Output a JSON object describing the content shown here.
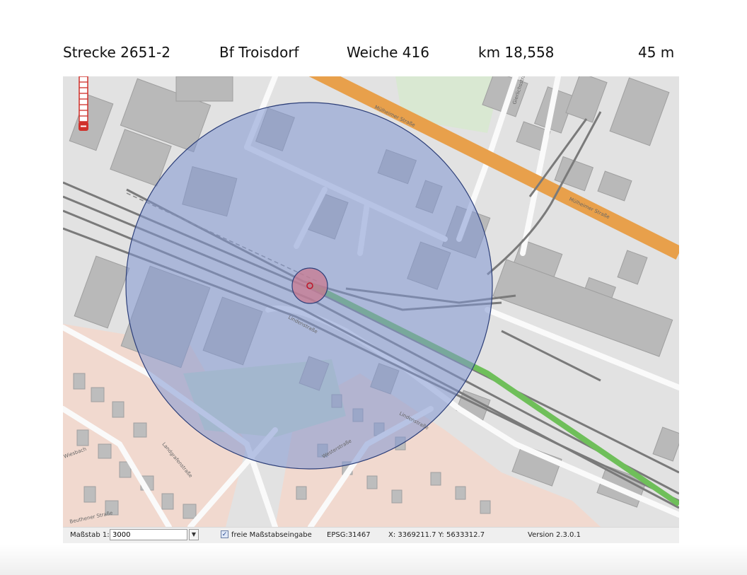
{
  "header": {
    "strecke": "Strecke 2651-2",
    "bahnhof": "Bf Troisdorf",
    "weiche": "Weiche 416",
    "km": "km 18,558",
    "radius": "45 m"
  },
  "map": {
    "street_labels": [
      "Mülheimer Straße",
      "Mülheimer Straße",
      "Lindenstraße",
      "Lindenstraße",
      "Landgrafenstraße",
      "Beuthener Straße",
      "Gierlichsstraße",
      "Wiesbach",
      "Westerstraße"
    ],
    "colors": {
      "background": "#e2e2e2",
      "buildings": "#b9b9b9",
      "residential": "#f1d9cf",
      "main_road": "#e8a04b",
      "track": "#7a7a7a",
      "highlight_track": "#6fbf5a",
      "buffer_circle": "#7f95d1",
      "switch_circle": "#c97a8f"
    }
  },
  "zoom": {
    "icon": "zoom-slider-icon",
    "minus_icon": "minus-icon"
  },
  "statusbar": {
    "scale_label": "Maßstab 1:",
    "scale_value": "3000",
    "dropdown_icon": "chevron-down-icon",
    "free_scale_label": "freie Maßstabseingabe",
    "free_scale_checked": true,
    "epsg": "EPSG:31467",
    "coords": "X: 3369211.7 Y: 5633312.7",
    "version": "Version 2.3.0.1"
  }
}
